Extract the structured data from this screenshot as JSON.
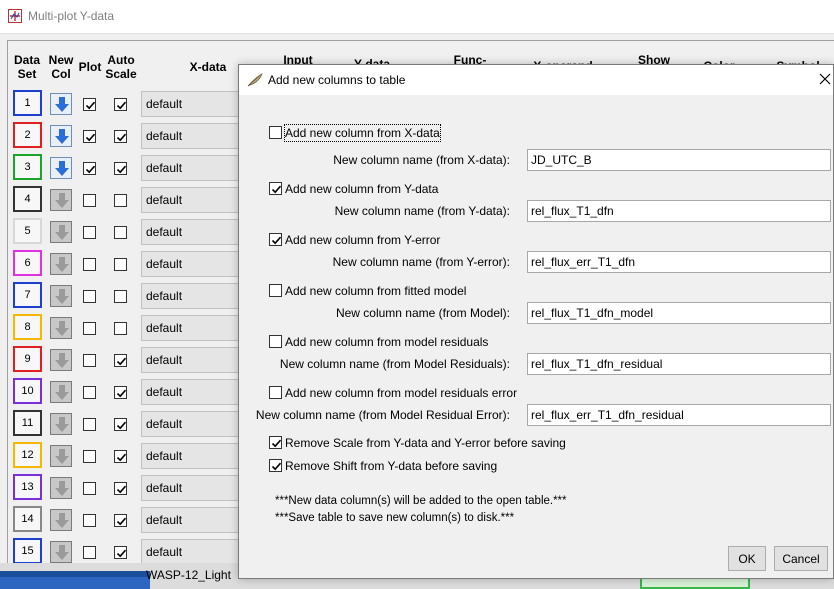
{
  "background_window": {
    "title": "Multi-plot Y-data",
    "headers": {
      "data_set": "Data Set",
      "new_col": "New Col",
      "plot": "Plot",
      "auto_scale": "Auto Scale",
      "x_data": "X-data",
      "input": "Input",
      "y_data": "Y-data",
      "func": "Func-",
      "x_operand": "X-operand",
      "show": "Show",
      "color": "Color",
      "symbol": "Symbol"
    },
    "rows": [
      {
        "num": "1",
        "color": "#1f3fd0",
        "new_col_enabled": true,
        "plot": true,
        "auto_scale": true,
        "x_data": "default"
      },
      {
        "num": "2",
        "color": "#e02020",
        "new_col_enabled": true,
        "plot": true,
        "auto_scale": true,
        "x_data": "default"
      },
      {
        "num": "3",
        "color": "#1aa52a",
        "new_col_enabled": true,
        "plot": true,
        "auto_scale": true,
        "x_data": "default"
      },
      {
        "num": "4",
        "color": "#333333",
        "new_col_enabled": false,
        "plot": false,
        "auto_scale": false,
        "x_data": "default"
      },
      {
        "num": "5",
        "color": "#d8d8d8",
        "new_col_enabled": false,
        "plot": false,
        "auto_scale": false,
        "x_data": "default"
      },
      {
        "num": "6",
        "color": "#e030e0",
        "new_col_enabled": false,
        "plot": false,
        "auto_scale": false,
        "x_data": "default"
      },
      {
        "num": "7",
        "color": "#1f3fd0",
        "new_col_enabled": false,
        "plot": false,
        "auto_scale": false,
        "x_data": "default"
      },
      {
        "num": "8",
        "color": "#f5b800",
        "new_col_enabled": false,
        "plot": false,
        "auto_scale": false,
        "x_data": "default"
      },
      {
        "num": "9",
        "color": "#e02020",
        "new_col_enabled": false,
        "plot": false,
        "auto_scale": true,
        "x_data": "default"
      },
      {
        "num": "10",
        "color": "#7a30d8",
        "new_col_enabled": false,
        "plot": false,
        "auto_scale": true,
        "x_data": "default"
      },
      {
        "num": "11",
        "color": "#333333",
        "new_col_enabled": false,
        "plot": false,
        "auto_scale": true,
        "x_data": "default"
      },
      {
        "num": "12",
        "color": "#f5b800",
        "new_col_enabled": false,
        "plot": false,
        "auto_scale": true,
        "x_data": "default"
      },
      {
        "num": "13",
        "color": "#7a30d8",
        "new_col_enabled": false,
        "plot": false,
        "auto_scale": true,
        "x_data": "default"
      },
      {
        "num": "14",
        "color": "#888888",
        "new_col_enabled": false,
        "plot": false,
        "auto_scale": true,
        "x_data": "default"
      },
      {
        "num": "15",
        "color": "#1f3fd0",
        "new_col_enabled": false,
        "plot": false,
        "auto_scale": true,
        "x_data": "default"
      }
    ],
    "bottom_tab": "WASP-12_Light"
  },
  "dialog": {
    "title": "Add new columns to table",
    "options": [
      {
        "checkbox_label": "Add new column from X-data",
        "checked": false,
        "name_label": "New column name (from X-data):",
        "value": "JD_UTC_B"
      },
      {
        "checkbox_label": "Add new column from Y-data",
        "checked": true,
        "name_label": "New column name (from Y-data):",
        "value": "rel_flux_T1_dfn"
      },
      {
        "checkbox_label": "Add new column from Y-error",
        "checked": true,
        "name_label": "New column name (from Y-error):",
        "value": "rel_flux_err_T1_dfn"
      },
      {
        "checkbox_label": "Add new column from fitted model",
        "checked": false,
        "name_label": "New column name (from Model):",
        "value": "rel_flux_T1_dfn_model"
      },
      {
        "checkbox_label": "Add new column from model residuals",
        "checked": false,
        "name_label": "New column name (from Model Residuals):",
        "value": "rel_flux_T1_dfn_residual"
      },
      {
        "checkbox_label": "Add new column from model residuals error",
        "checked": false,
        "name_label": "New column name (from Model Residual Error):",
        "value": "rel_flux_err_T1_dfn_residual"
      }
    ],
    "remove_scale_label": "Remove Scale from Y-data and Y-error before saving",
    "remove_scale_checked": true,
    "remove_shift_label": "Remove Shift from Y-data before saving",
    "remove_shift_checked": true,
    "note1": "***New data column(s) will be added to the open table.***",
    "note2": "***Save table to save new column(s) to disk.***",
    "ok_label": "OK",
    "cancel_label": "Cancel"
  }
}
